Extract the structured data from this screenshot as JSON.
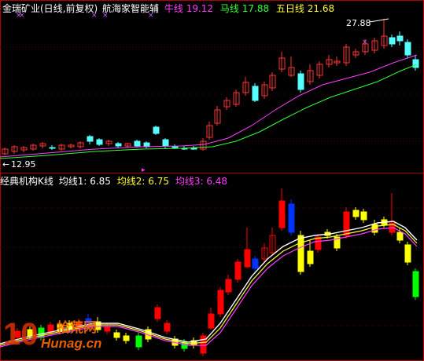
{
  "top_panel": {
    "stock_title": "金瑞矿业(日线,前复权)",
    "indicator_name": "航海家智能辅",
    "lines": [
      {
        "label": "牛线",
        "value": "19.12",
        "color": "#ff3cff"
      },
      {
        "label": "马线",
        "value": "17.88",
        "color": "#33ff33"
      },
      {
        "label": "五日线",
        "value": "21.68",
        "color": "#ffff33"
      }
    ],
    "high_label": "27.88",
    "low_label": "12.95"
  },
  "bottom_panel": {
    "indicator_name": "经典机构K线",
    "averages": [
      {
        "label": "均线1:",
        "value": "6.85",
        "color": "#ffffff"
      },
      {
        "label": "均线2:",
        "value": "6.75",
        "color": "#ffff33"
      },
      {
        "label": "均线3:",
        "value": "6.48",
        "color": "#ff3cff"
      }
    ]
  },
  "watermark": {
    "number": "10",
    "brand": "拾荒网",
    "url": "Hunag.cn"
  },
  "colors": {
    "up": "#ff3333",
    "down": "#54ffff",
    "panel_border": "#b00000",
    "vol_yellow": "#ffff00",
    "vol_red": "#ff0000",
    "vol_green": "#00ff00",
    "vol_blue": "#0033ff"
  }
}
